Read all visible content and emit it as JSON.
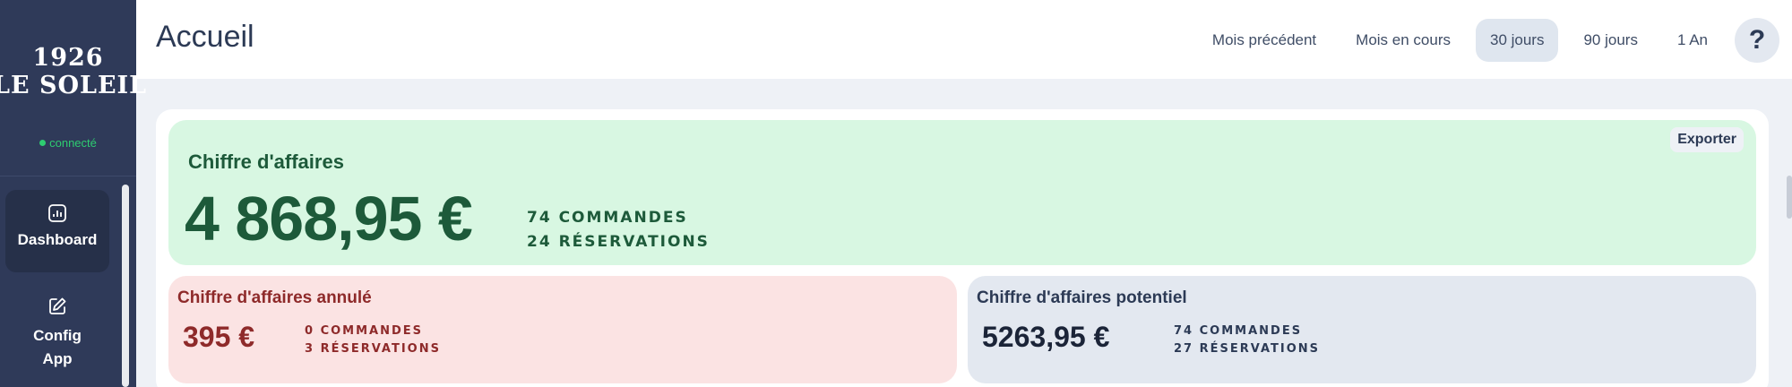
{
  "brand": {
    "line1": "1926",
    "line2": "LE SOLEIL",
    "status": "connecté"
  },
  "sidebar": {
    "items": [
      {
        "label": "Dashboard",
        "icon": "chart-icon",
        "active": true
      },
      {
        "label_line1": "Config",
        "label_line2": "App",
        "icon": "edit-icon",
        "active": false
      }
    ]
  },
  "header": {
    "title": "Accueil",
    "tabs": [
      "Mois précédent",
      "Mois en cours",
      "30 jours",
      "90 jours",
      "1 An"
    ],
    "active_tab": "30 jours",
    "help_label": "?"
  },
  "revenue": {
    "title": "Chiffre d'affaires",
    "amount": "4 868,95 €",
    "orders": "74 COMMANDES",
    "reservations": "24 RÉSERVATIONS",
    "export_label": "Exporter"
  },
  "cancelled": {
    "title": "Chiffre d'affaires annulé",
    "amount": "395 €",
    "orders": "0 COMMANDES",
    "reservations": "3 RÉSERVATIONS"
  },
  "potential": {
    "title": "Chiffre d'affaires potentiel",
    "amount": "5263,95 €",
    "orders": "74 COMMANDES",
    "reservations": "27 RÉSERVATIONS"
  },
  "colors": {
    "sidebar": "#2f3a59",
    "revenue_bg": "#d8f7e2",
    "cancel_bg": "#fbe3e3",
    "potential_bg": "#e3e8f0",
    "status_green": "#2ecc71"
  }
}
